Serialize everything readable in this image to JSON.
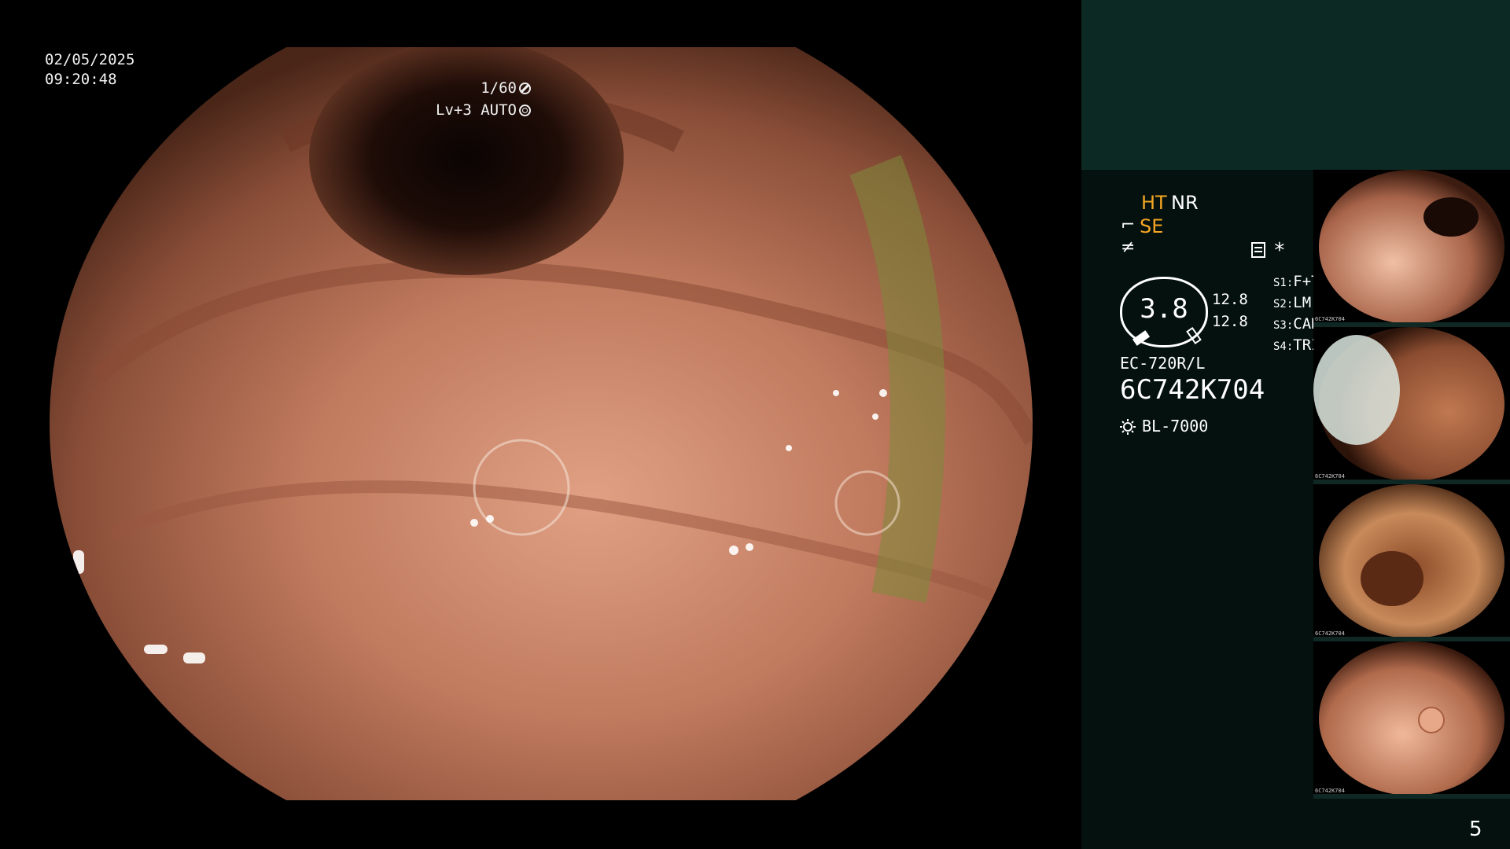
{
  "osd": {
    "date": "02/05/2025",
    "time": "09:20:48",
    "shutter": "1/60",
    "level": "Lv+3 AUTO"
  },
  "status": {
    "ht": "HT",
    "nr": "NR",
    "se": "SE",
    "zoom": "3.8",
    "zoom_side_a": "12.8",
    "zoom_side_b": "12.8",
    "switches": [
      {
        "key": "S1:",
        "value": "F+T"
      },
      {
        "key": "S2:",
        "value": "LM"
      },
      {
        "key": "S3:",
        "value": "CAD"
      },
      {
        "key": "S4:",
        "value": "TRIG"
      }
    ],
    "scope_model": "EC-720R/L",
    "scope_serial": "6C742K704",
    "light_source": "BL-7000"
  },
  "thumbnails": [
    {
      "caption": "6C742K704"
    },
    {
      "caption": "6C742K704"
    },
    {
      "caption": "6C742K704"
    },
    {
      "caption": "6C742K704"
    }
  ],
  "page": {
    "number": "5"
  },
  "colors": {
    "highlight": "#f5a623",
    "panel_bg": "#04110e",
    "panel_header": "#0d2924"
  },
  "icons": [
    "shutter-icon",
    "auto-level-icon",
    "record-icon",
    "light-source-icon"
  ]
}
